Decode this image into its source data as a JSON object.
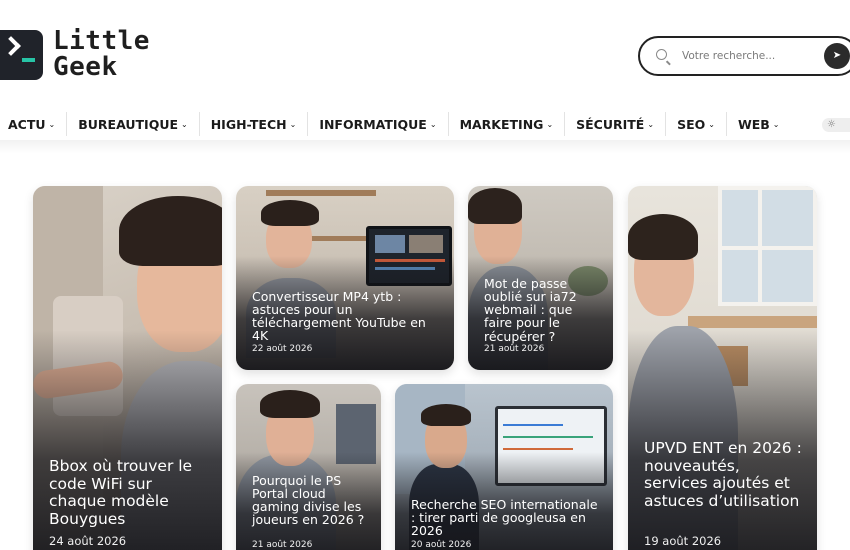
{
  "header": {
    "logo_line1": "Little",
    "logo_line2": "Geek",
    "search_placeholder": "Votre recherche..."
  },
  "nav": {
    "items": [
      {
        "label": "ACTU"
      },
      {
        "label": "BUREAUTIQUE"
      },
      {
        "label": "HIGH-TECH"
      },
      {
        "label": "INFORMATIQUE"
      },
      {
        "label": "MARKETING"
      },
      {
        "label": "SÉCURITÉ"
      },
      {
        "label": "SEO"
      },
      {
        "label": "WEB"
      }
    ]
  },
  "articles": [
    {
      "title": "Bbox où trouver le code WiFi sur chaque modèle Bouygues",
      "date": "24 août 2026"
    },
    {
      "title": "Convertisseur MP4 ytb : astuces pour un téléchargement YouTube en 4K",
      "date": "22 août 2026"
    },
    {
      "title": "Mot de passe oublié sur ia72 webmail : que faire pour le récupérer ?",
      "date": "21 août 2026"
    },
    {
      "title": "UPVD ENT en 2026 : nouveautés, services ajoutés et astuces d’utilisation",
      "date": "19 août 2026"
    },
    {
      "title": "Pourquoi le PS Portal cloud gaming divise les joueurs en 2026 ?",
      "date": "21 août 2026"
    },
    {
      "title": "Recherche SEO internationale : tirer parti de googleusa en 2026",
      "date": "20 août 2026"
    }
  ],
  "colors": {
    "accent": "#27c4a6",
    "logo_bg": "#20232a",
    "text": "#1b1b1b"
  }
}
